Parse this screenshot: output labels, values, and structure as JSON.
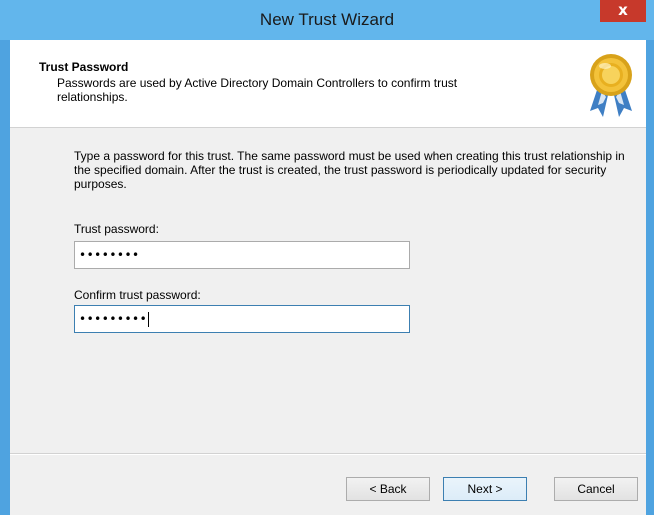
{
  "window": {
    "title": "New Trust Wizard",
    "close_glyph": "x"
  },
  "header": {
    "title": "Trust Password",
    "description": "Passwords are used by Active Directory Domain Controllers to confirm trust relationships.",
    "icon": "award-ribbon-icon"
  },
  "body": {
    "instructions": "Type a password for this trust. The same password must be used when creating this trust relationship in the specified domain. After the trust is created, the trust password is periodically updated for security purposes."
  },
  "fields": {
    "trust_password": {
      "label": "Trust password:",
      "value": "••••••••"
    },
    "confirm_password": {
      "label": "Confirm trust password:",
      "value": "•••••••••"
    }
  },
  "buttons": {
    "back": "< Back",
    "next": "Next >",
    "cancel": "Cancel"
  },
  "colors": {
    "title_bar": "#62b6ec",
    "close_button": "#c7392b",
    "dialog_background": "#f0f0f0"
  }
}
